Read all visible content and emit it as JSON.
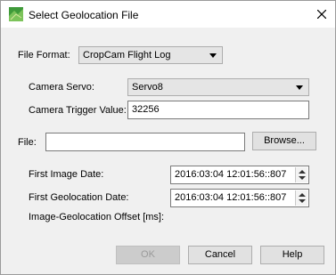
{
  "window": {
    "title": "Select Geolocation File",
    "icon": "map-app-icon",
    "close_icon": "close-icon"
  },
  "file_format": {
    "label": "File Format:",
    "value": "CropCam Flight Log"
  },
  "camera_servo": {
    "label": "Camera Servo:",
    "value": "Servo8"
  },
  "camera_trigger": {
    "label": "Camera Trigger Value:",
    "value": "32256"
  },
  "file": {
    "label": "File:",
    "value": "",
    "browse_label": "Browse..."
  },
  "first_image_date": {
    "label": "First Image Date:",
    "value": "2016:03:04 12:01:56::807"
  },
  "first_geolocation_date": {
    "label": "First Geolocation Date:",
    "value": "2016:03:04 12:01:56::807"
  },
  "offset": {
    "label": "Image-Geolocation Offset [ms]:"
  },
  "buttons": {
    "ok": "OK",
    "cancel": "Cancel",
    "help": "Help"
  }
}
